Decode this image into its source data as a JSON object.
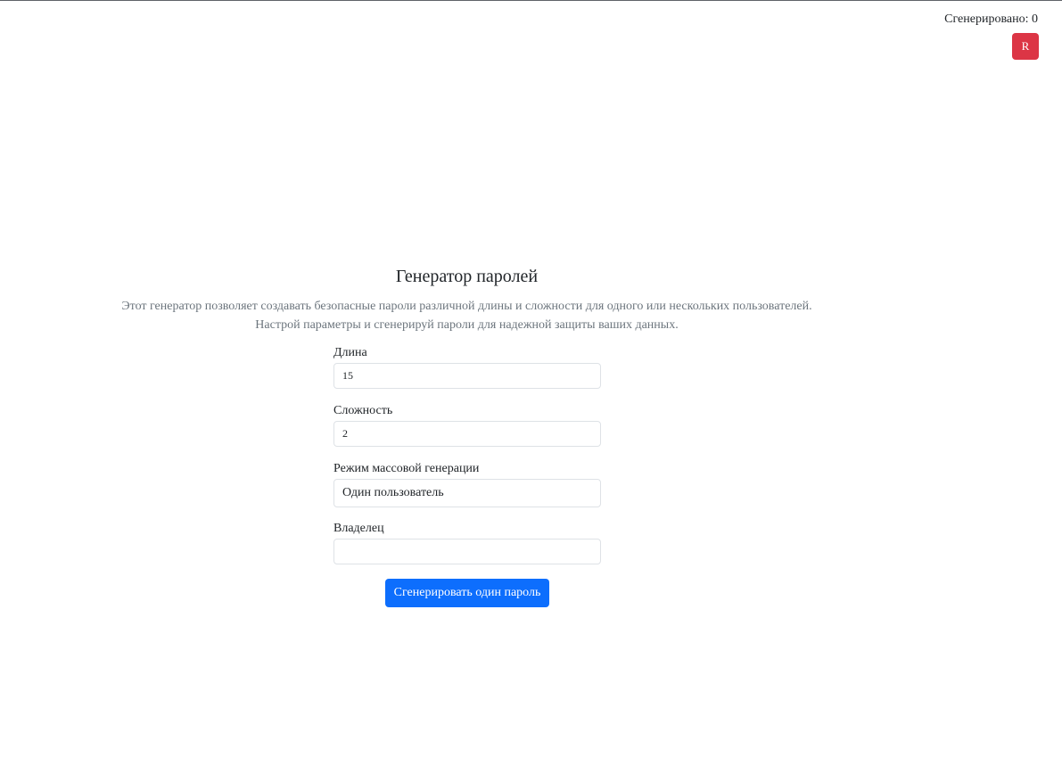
{
  "header": {
    "counter_text": "Сгенерировано: 0",
    "avatar_letter": "R"
  },
  "main": {
    "title": "Генератор паролей",
    "description_line1": "Этот генератор позволяет создавать безопасные пароли различной длины и сложности для одного или нескольких пользователей.",
    "description_line2": "Настрой параметры и сгенерируй пароли для надежной защиты ваших данных."
  },
  "form": {
    "length": {
      "label": "Длина",
      "value": "15"
    },
    "complexity": {
      "label": "Сложность",
      "value": "2"
    },
    "mode": {
      "label": "Режим массовой генерации",
      "selected": "Один пользователь"
    },
    "owner": {
      "label": "Владелец",
      "value": ""
    },
    "submit_label": "Сгенерировать один пароль"
  },
  "colors": {
    "accent": "#0d6efd",
    "avatar_bg": "#dc3545",
    "muted_text": "#6c757d"
  }
}
